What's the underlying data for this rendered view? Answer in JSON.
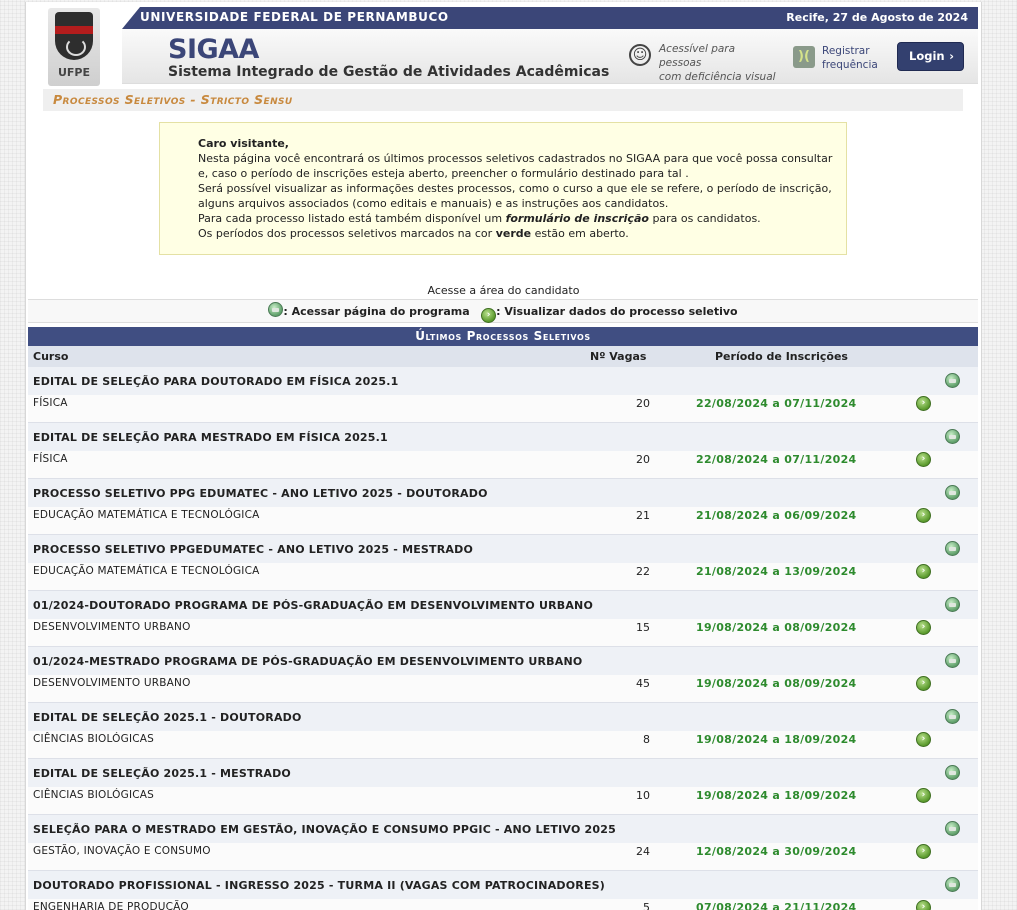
{
  "header": {
    "university": "UNIVERSIDADE FEDERAL DE PERNAMBUCO",
    "date": "Recife, 27 de Agosto de 2024",
    "logo_text": "UFPE",
    "system_name": "SIGAA",
    "system_subtitle": "Sistema Integrado de Gestão de Atividades Acadêmicas",
    "accessibility": [
      "Acessível para pessoas",
      "com deficiência visual"
    ],
    "register": [
      "Registrar",
      "frequência"
    ],
    "login_label": "Login",
    "login_arrow": "›"
  },
  "page_title": "Processos Seletivos - Stricto Sensu",
  "notice": {
    "greeting": "Caro visitante,",
    "lines": [
      "Nesta página você encontrará os últimos processos seletivos cadastrados no SIGAA para que você possa consultar e, caso o período de inscrições esteja aberto, preencher o formulário destinado para tal .",
      "Será possível visualizar as informações destes processos, como o curso a que ele se refere, o período de inscrição, alguns arquivos associados (como editais e manuais) e as instruções aos candidatos."
    ],
    "form_prefix": "Para cada processo listado está também disponível um",
    "form_emph": "formulário de inscrição",
    "form_suffix": "para os candidatos.",
    "open_prefix": "Os períodos dos processos seletivos marcados na cor",
    "open_emph": "verde",
    "open_suffix": "estão em aberto."
  },
  "candidate_link": "Acesse a área do candidato",
  "legend": {
    "program": ": Acessar página do programa",
    "view": ": Visualizar dados do processo seletivo"
  },
  "table": {
    "title": "Últimos Processos Seletivos",
    "col_course": "Curso",
    "col_vagas": "Nº Vagas",
    "col_period": "Período de Inscrições",
    "open_color": "#2e8b2e",
    "rows": [
      {
        "title": "EDITAL DE SELEÇÃO PARA DOUTORADO EM FÍSICA 2025.1",
        "course": "FÍSICA",
        "vagas": "20",
        "period": "22/08/2024 a 07/11/2024"
      },
      {
        "title": "EDITAL DE SELEÇÃO PARA MESTRADO EM FÍSICA 2025.1",
        "course": "FÍSICA",
        "vagas": "20",
        "period": "22/08/2024 a 07/11/2024"
      },
      {
        "title": "PROCESSO SELETIVO PPG EDUMATEC - ANO LETIVO 2025 - DOUTORADO",
        "course": "EDUCAÇÃO MATEMÁTICA E TECNOLÓGICA",
        "vagas": "21",
        "period": "21/08/2024 a 06/09/2024"
      },
      {
        "title": "PROCESSO SELETIVO PPGEDUMATEC - ANO LETIVO 2025 - MESTRADO",
        "course": "EDUCAÇÃO MATEMÁTICA E TECNOLÓGICA",
        "vagas": "22",
        "period": "21/08/2024 a 13/09/2024"
      },
      {
        "title": "01/2024-DOUTORADO PROGRAMA DE PÓS-GRADUAÇÃO EM DESENVOLVIMENTO URBANO",
        "course": "DESENVOLVIMENTO URBANO",
        "vagas": "15",
        "period": "19/08/2024 a 08/09/2024"
      },
      {
        "title": "01/2024-MESTRADO PROGRAMA DE PÓS-GRADUAÇÃO EM DESENVOLVIMENTO URBANO",
        "course": "DESENVOLVIMENTO URBANO",
        "vagas": "45",
        "period": "19/08/2024 a 08/09/2024"
      },
      {
        "title": "EDITAL DE SELEÇÃO 2025.1 - DOUTORADO",
        "course": "CIÊNCIAS BIOLÓGICAS",
        "vagas": "8",
        "period": "19/08/2024 a 18/09/2024"
      },
      {
        "title": "EDITAL DE SELEÇÃO 2025.1 - MESTRADO",
        "course": "CIÊNCIAS BIOLÓGICAS",
        "vagas": "10",
        "period": "19/08/2024 a 18/09/2024"
      },
      {
        "title": "SELEÇÃO PARA O MESTRADO EM GESTÃO, INOVAÇÃO E CONSUMO PPGIC - ANO LETIVO 2025",
        "course": "GESTÃO, INOVAÇÃO E CONSUMO",
        "vagas": "24",
        "period": "12/08/2024 a 30/09/2024"
      },
      {
        "title": "DOUTORADO PROFISSIONAL - INGRESSO 2025 - TURMA II (VAGAS COM PATROCINADORES)",
        "course": "ENGENHARIA DE PRODUÇÃO",
        "vagas": "5",
        "period": "07/08/2024 a 21/11/2024"
      }
    ]
  }
}
